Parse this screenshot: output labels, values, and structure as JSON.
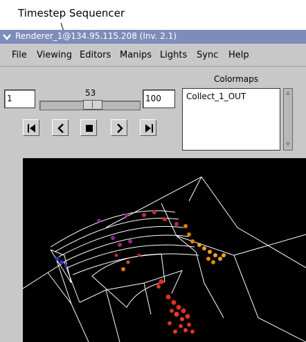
{
  "callout": {
    "label": "Timestep Sequencer"
  },
  "window": {
    "title": "Renderer_1@134.95.115.208 (Inv. 2.1)"
  },
  "menubar": {
    "items": [
      "File",
      "Viewing",
      "Editors",
      "Manips",
      "Lights",
      "Sync",
      "Help"
    ]
  },
  "sequencer": {
    "min_value": "1",
    "max_value": "100",
    "current_value": "53",
    "position_fraction": 0.53,
    "buttons": [
      "step-to-start",
      "step-back",
      "stop",
      "step-forward",
      "step-to-end"
    ]
  },
  "colormaps": {
    "label": "Colormaps",
    "items": [
      "Collect_1_OUT"
    ]
  },
  "viewport": {
    "background": "#000000",
    "wireframe_color": "#ffffff",
    "particle_colors": [
      "#3030c0",
      "#8a2a8a",
      "#c02a3a",
      "#e03020",
      "#e07a10",
      "#f0a020"
    ]
  }
}
